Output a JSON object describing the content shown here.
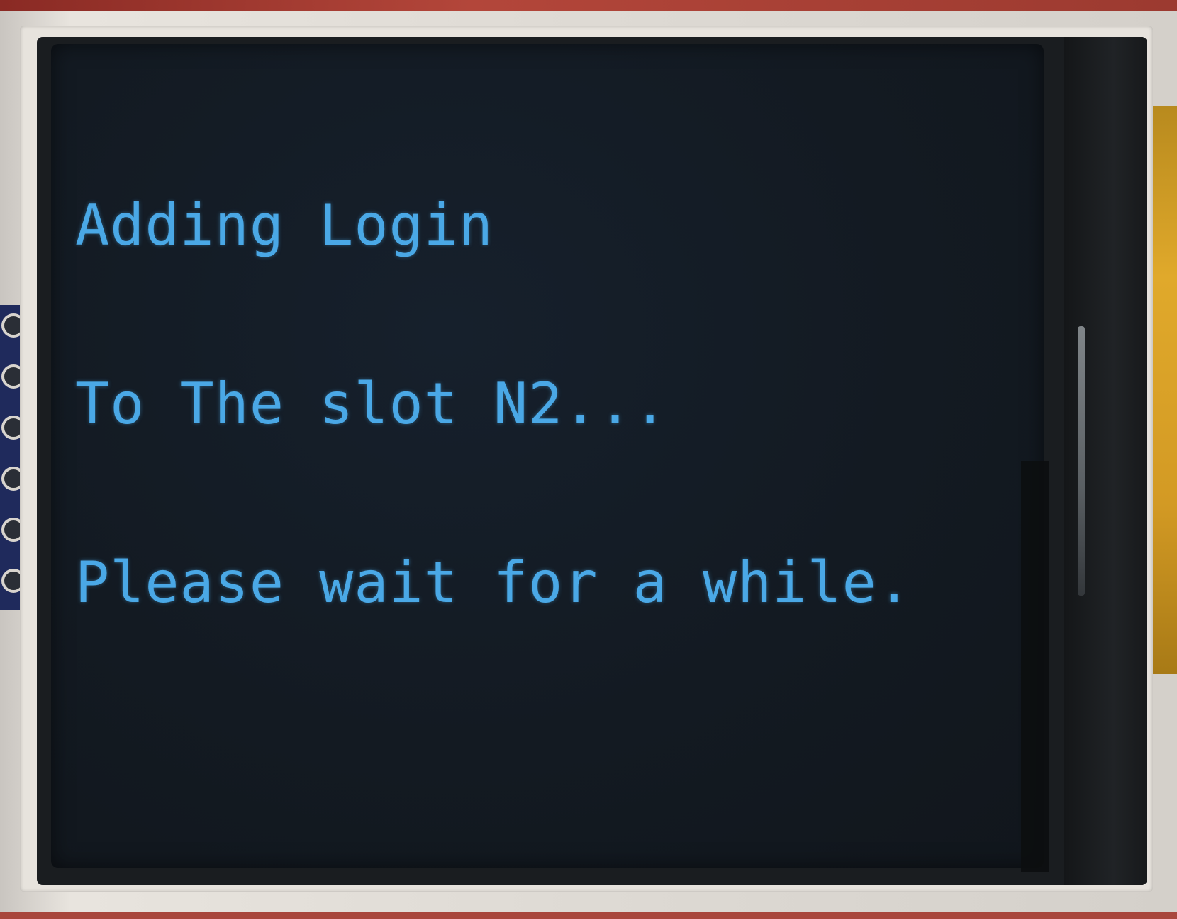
{
  "display": {
    "text_color": "#4aa8e6",
    "background_color": "#131a22",
    "lines": [
      "Adding Login",
      "To The slot N2...",
      "Please wait for a while."
    ]
  }
}
